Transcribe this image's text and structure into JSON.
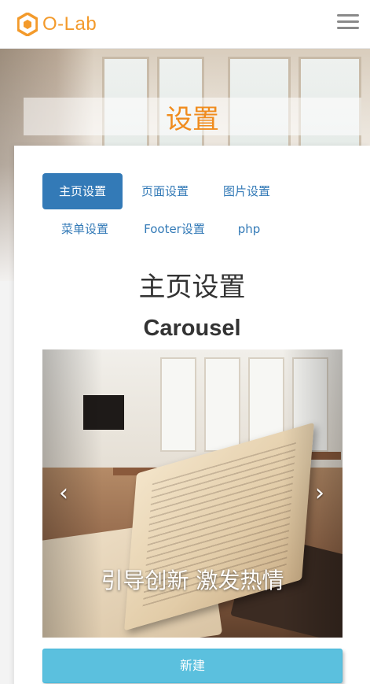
{
  "brand": {
    "logo_text": "O-Lab",
    "accent_color": "#f39a2b"
  },
  "header": {
    "menu_icon": "hamburger-menu-icon"
  },
  "hero": {
    "title": "设置"
  },
  "tabs": [
    {
      "label": "主页设置",
      "active": true
    },
    {
      "label": "页面设置",
      "active": false
    },
    {
      "label": "图片设置",
      "active": false
    },
    {
      "label": "菜单设置",
      "active": false
    },
    {
      "label": "Footer设置",
      "active": false
    },
    {
      "label": "php",
      "active": false
    }
  ],
  "main": {
    "section_title": "主页设置",
    "subsection_title": "Carousel"
  },
  "carousel": {
    "caption": "引导创新 激发热情",
    "prev_icon": "chevron-left-icon",
    "next_icon": "chevron-right-icon"
  },
  "actions": {
    "new_label": "新建",
    "new_color": "#5bc0de"
  },
  "colors": {
    "tab_active_bg": "#337ab7",
    "title_color": "#f08c1e"
  }
}
